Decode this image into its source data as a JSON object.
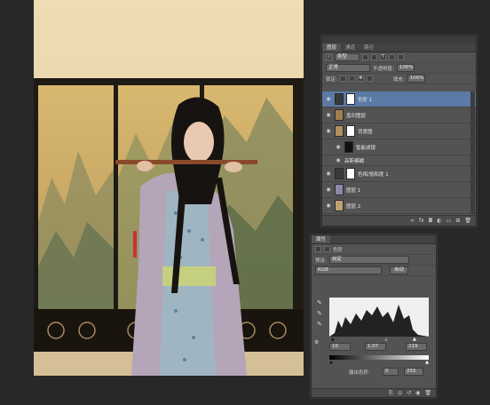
{
  "layers_panel": {
    "tabs": [
      "图层",
      "通道",
      "路径"
    ],
    "kind_select": "类型",
    "blend_mode": "正常",
    "opacity_label": "不透明度:",
    "opacity_value": "100%",
    "lock_label": "锁定:",
    "fill_label": "填充:",
    "fill_value": "100%",
    "layers": [
      {
        "name": "色阶 1",
        "selected": true
      },
      {
        "name": "盖印图层",
        "selected": false
      },
      {
        "name": "背景图",
        "selected": false
      },
      {
        "name": "智能滤镜",
        "selected": false
      },
      {
        "name": "高斯模糊",
        "selected": false
      },
      {
        "name": "色相/饱和度 1",
        "selected": false
      },
      {
        "name": "图层 1",
        "selected": false
      },
      {
        "name": "图层 2",
        "selected": false
      }
    ],
    "footer_icons": [
      "∞",
      "fx",
      "◘",
      "◐",
      "▭",
      "⊞",
      "🗑"
    ]
  },
  "properties_panel": {
    "tab": "属性",
    "title": "色阶",
    "preset_label": "预设:",
    "preset_value": "自定",
    "channel": "RGB",
    "auto_button": "自动",
    "input_black": "10",
    "input_mid": "1.07",
    "input_white": "219",
    "output_label": "输出色阶:",
    "output_black": "0",
    "output_white": "255"
  },
  "colors": {
    "panel_bg": "#535353",
    "selected_layer": "#5b7ba6",
    "workspace": "#282828"
  }
}
